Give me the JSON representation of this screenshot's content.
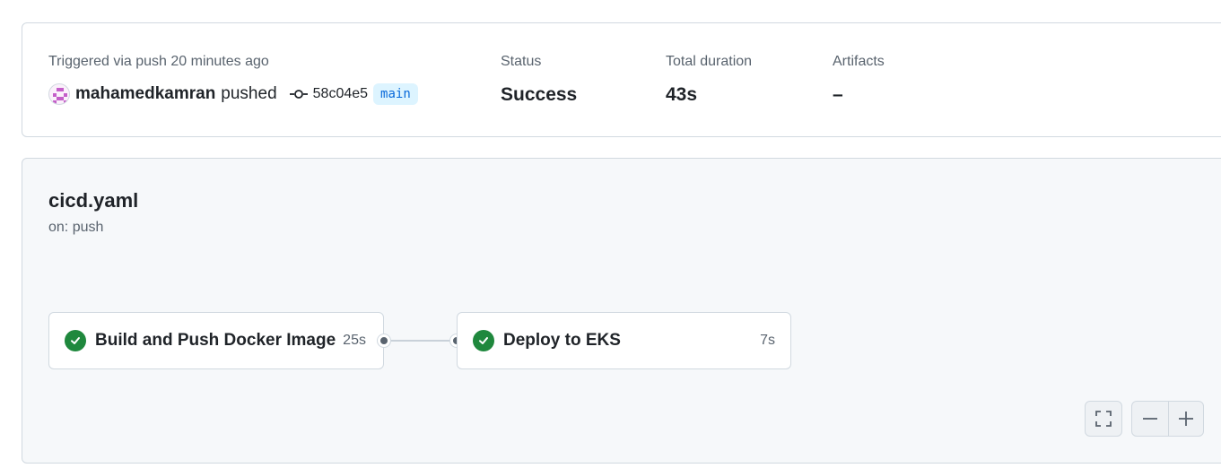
{
  "run_summary": {
    "trigger_label": "Triggered via push 20 minutes ago",
    "actor": "mahamedkamran",
    "action": "pushed",
    "commit_sha": "58c04e5",
    "branch": "main",
    "status_label": "Status",
    "status_value": "Success",
    "duration_label": "Total duration",
    "duration_value": "43s",
    "artifacts_label": "Artifacts",
    "artifacts_value": "–"
  },
  "workflow": {
    "file": "cicd.yaml",
    "trigger": "on: push",
    "jobs": [
      {
        "name": "Build and Push Docker Image",
        "duration": "25s",
        "status": "success"
      },
      {
        "name": "Deploy to EKS",
        "duration": "7s",
        "status": "success"
      }
    ]
  },
  "graph_controls": {
    "icons": [
      "fullscreen-icon",
      "zoom-out-icon",
      "zoom-in-icon"
    ]
  },
  "colors": {
    "success": "#1f883d",
    "branch_bg": "#ddf4ff",
    "branch_text": "#0969da",
    "muted_text": "#59636e"
  }
}
